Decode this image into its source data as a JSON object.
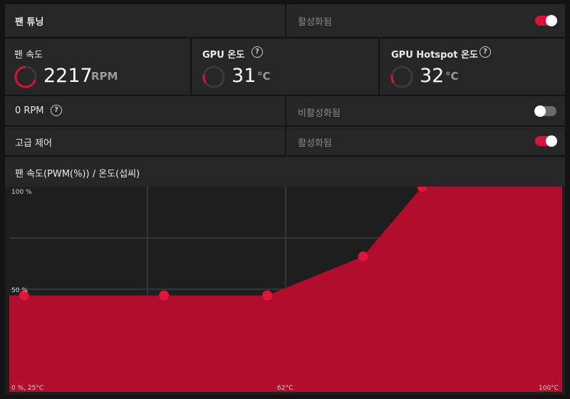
{
  "fan_tuning": {
    "title": "팬 튜닝",
    "status": "활성화됨",
    "enabled": true
  },
  "metrics": [
    {
      "label": "팬 속도",
      "value": "2217",
      "unit": "RPM",
      "help": false
    },
    {
      "label": "GPU 온도",
      "value": "31",
      "unit": "°C",
      "help": true
    },
    {
      "label": "GPU Hotspot 온도",
      "value": "32",
      "unit": "°C",
      "help": true
    }
  ],
  "zero_rpm": {
    "label": "0 RPM",
    "status": "비활성화됨",
    "enabled": false
  },
  "advanced_control": {
    "label": "고급 제어",
    "status": "활성화됨",
    "enabled": true
  },
  "curve_title": "팬 속도(PWM(%)) / 온도(섭씨)",
  "chart_data": {
    "type": "area",
    "x_unit": "°C",
    "y_unit": "%",
    "xlim": [
      25,
      100
    ],
    "ylim": [
      0,
      100
    ],
    "points": [
      {
        "x": 27,
        "y": 47
      },
      {
        "x": 46,
        "y": 47
      },
      {
        "x": 60,
        "y": 47
      },
      {
        "x": 73,
        "y": 66
      },
      {
        "x": 81,
        "y": 100
      }
    ],
    "tick_labels": {
      "y_top": "100 %",
      "y_mid": "50 %",
      "origin": "0 %, 25°C",
      "x_mid": "62°C",
      "x_end": "100°C"
    },
    "fill_color": "#b10d2d",
    "point_color": "#e3143c",
    "grid": true
  },
  "colors": {
    "accent": "#d6143a",
    "panel": "#262626",
    "background": "#141414"
  }
}
